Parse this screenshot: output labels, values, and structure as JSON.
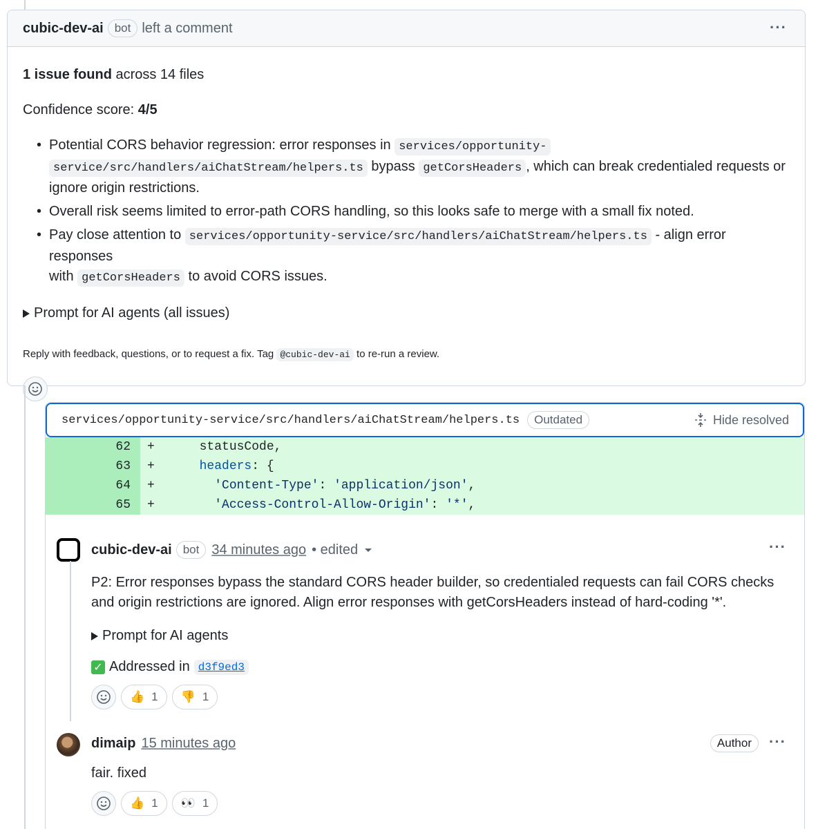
{
  "top_comment": {
    "author": "cubic-dev-ai",
    "badge": "bot",
    "action": "left a comment",
    "summary_bold": "1 issue found",
    "summary_rest": " across 14 files",
    "confidence_label": "Confidence score: ",
    "confidence_value": "4/5",
    "bullet1_a": "Potential CORS behavior regression: error responses in ",
    "bullet1_code1_line1": "services/opportunity-",
    "bullet1_code1_line2": "service/src/handlers/aiChatStream/helpers.ts",
    "bullet1_b": " bypass ",
    "bullet1_code2": "getCorsHeaders",
    "bullet1_c": ", which can break credentialed requests or",
    "bullet1_d": "ignore origin restrictions.",
    "bullet2": "Overall risk seems limited to error-path CORS handling, so this looks safe to merge with a small fix noted.",
    "bullet3_a": "Pay close attention to ",
    "bullet3_code1": "services/opportunity-service/src/handlers/aiChatStream/helpers.ts",
    "bullet3_b": " - align error responses",
    "bullet3_c": "with ",
    "bullet3_code2": "getCorsHeaders",
    "bullet3_d": " to avoid CORS issues.",
    "details_label": "Prompt for AI agents (all issues)",
    "reply_a": "Reply with feedback, questions, or to request a fix. Tag ",
    "reply_tag": "@cubic-dev-ai",
    "reply_b": " to re-run a review."
  },
  "thread": {
    "file_path": "services/opportunity-service/src/handlers/aiChatStream/helpers.ts",
    "outdated_label": "Outdated",
    "hide_resolved_label": "Hide resolved",
    "diff": [
      {
        "line": "62",
        "sign": "+",
        "indent": "    ",
        "parts": [
          {
            "t": "statusCode,",
            "c": "plain"
          }
        ]
      },
      {
        "line": "63",
        "sign": "+",
        "indent": "    ",
        "parts": [
          {
            "t": "headers",
            "c": "kw"
          },
          {
            "t": ": {",
            "c": "plain"
          }
        ]
      },
      {
        "line": "64",
        "sign": "+",
        "indent": "      ",
        "parts": [
          {
            "t": "'Content-Type'",
            "c": "str"
          },
          {
            "t": ": ",
            "c": "plain"
          },
          {
            "t": "'application/json'",
            "c": "str"
          },
          {
            "t": ",",
            "c": "plain"
          }
        ]
      },
      {
        "line": "65",
        "sign": "+",
        "indent": "      ",
        "parts": [
          {
            "t": "'Access-Control-Allow-Origin'",
            "c": "str"
          },
          {
            "t": ": ",
            "c": "plain"
          },
          {
            "t": "'*'",
            "c": "str"
          },
          {
            "t": ",",
            "c": "plain"
          }
        ]
      }
    ],
    "review_comment": {
      "author": "cubic-dev-ai",
      "badge": "bot",
      "time": "34 minutes ago",
      "edited": "• edited",
      "body_line1": "P2: Error responses bypass the standard CORS header builder, so credentialed requests can fail CORS checks",
      "body_line2": "and origin restrictions are ignored. Align error responses with getCorsHeaders instead of hard-coding '*'.",
      "details_label": "Prompt for AI agents",
      "addressed_label": "Addressed in",
      "commit_sha": "d3f9ed3",
      "reactions": [
        {
          "icon": "thumbs-up-icon",
          "emoji": "👍",
          "count": "1"
        },
        {
          "icon": "thumbs-down-icon",
          "emoji": "👎",
          "count": "1"
        }
      ]
    },
    "reply_comment": {
      "author": "dimaip",
      "time": "15 minutes ago",
      "role_badge": "Author",
      "body": "fair. fixed",
      "reactions": [
        {
          "icon": "thumbs-up-icon",
          "emoji": "👍",
          "count": "1"
        },
        {
          "icon": "eyes-icon",
          "emoji": "👀",
          "count": "1"
        }
      ]
    }
  }
}
